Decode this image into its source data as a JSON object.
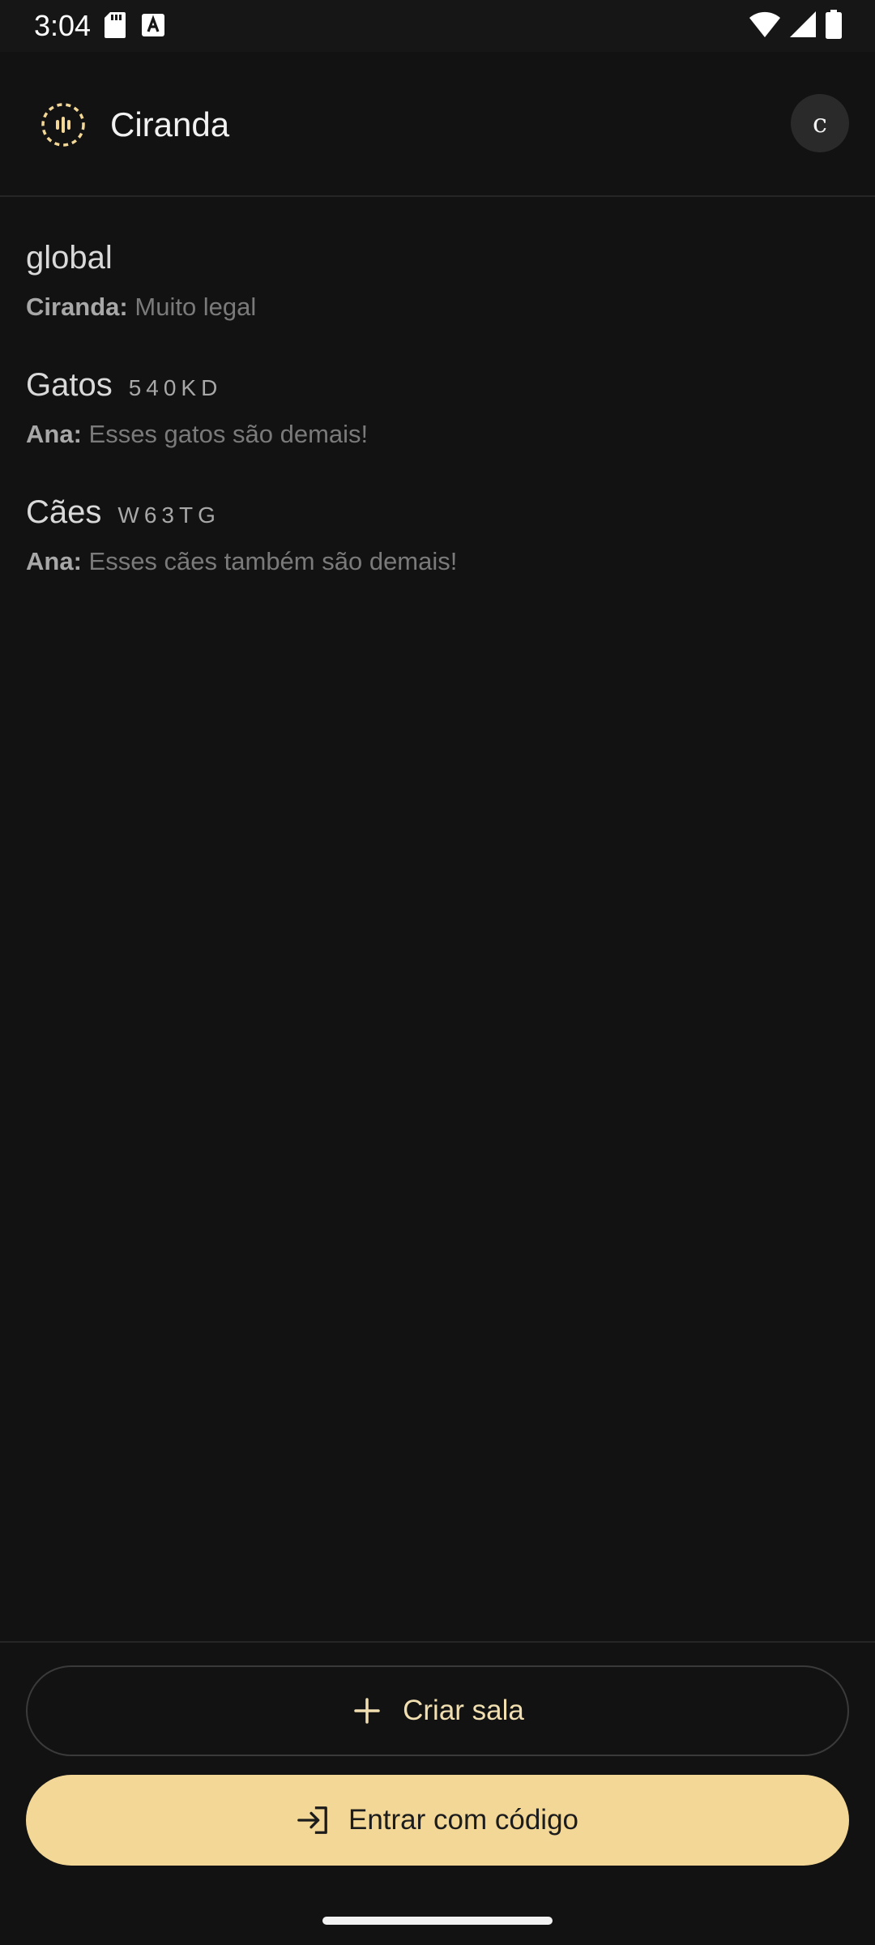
{
  "status_bar": {
    "time": "3:04",
    "left_icons": [
      "sd-card-icon",
      "keyboard-a-icon"
    ],
    "right_icons": [
      "wifi-icon",
      "cell-signal-icon",
      "battery-icon"
    ]
  },
  "app_bar": {
    "title": "Ciranda",
    "logo_icon": "ciranda-logo-icon",
    "avatar_initial": "c"
  },
  "rooms": [
    {
      "name": "global",
      "code": "",
      "last_sender": "Ciranda:",
      "last_message": "Muito legal"
    },
    {
      "name": "Gatos",
      "code": "540KD",
      "last_sender": "Ana:",
      "last_message": "Esses gatos são demais!"
    },
    {
      "name": "Cães",
      "code": "W63TG",
      "last_sender": "Ana:",
      "last_message": "Esses cães também são demais!"
    }
  ],
  "actions": {
    "create_room_label": "Criar sala",
    "create_room_icon": "plus-icon",
    "join_code_label": "Entrar com código",
    "join_code_icon": "login-arrow-icon"
  },
  "colors": {
    "background": "#121212",
    "accent": "#F3D796",
    "accent_text": "#F1DFB2"
  }
}
